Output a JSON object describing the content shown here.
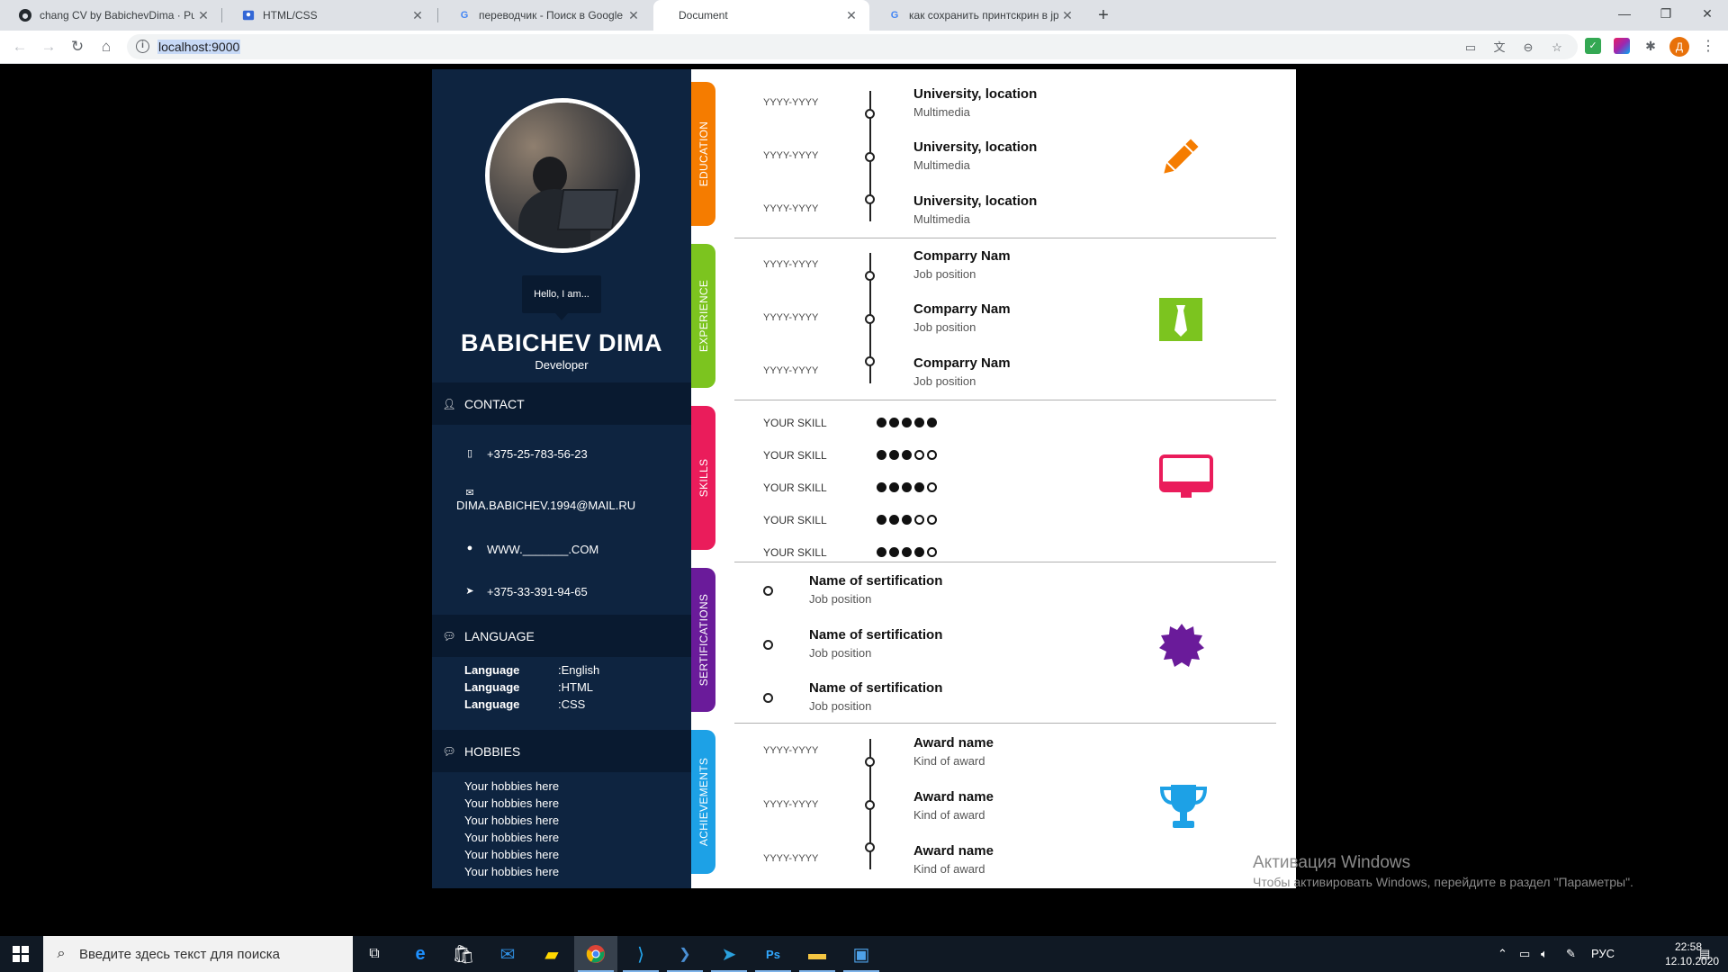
{
  "browser": {
    "tabs": [
      {
        "title": "chang CV by BabichevDima · Pul",
        "icon": "github-icon",
        "active": false
      },
      {
        "title": "HTML/CSS",
        "icon": "page-icon",
        "active": false
      },
      {
        "title": "переводчик - Поиск в Google",
        "icon": "google-icon",
        "active": false
      },
      {
        "title": "Document",
        "icon": "none",
        "active": true
      },
      {
        "title": "как сохранить принтскрин в jpg",
        "icon": "google-icon",
        "active": false
      }
    ],
    "url": "localhost:9000"
  },
  "cv": {
    "greeting": "Hello, I am...",
    "name": "BABICHEV DIMA",
    "role": "Developer",
    "contact": {
      "heading": "CONTACT",
      "phone": "+375-25-783-56-23",
      "email": "DIMA.BABICHEV.1994@MAIL.RU",
      "website": "WWW._______.COM",
      "telegram": "+375-33-391-94-65"
    },
    "language": {
      "heading": "LANGUAGE",
      "items": [
        {
          "label": "Language",
          "value": ":English"
        },
        {
          "label": "Language",
          "value": ":HTML"
        },
        {
          "label": "Language",
          "value": ":CSS"
        }
      ]
    },
    "hobbies": {
      "heading": "HOBBIES",
      "items": [
        "Your hobbies here",
        "Your hobbies here",
        "Your hobbies here",
        "Your hobbies here",
        "Your hobbies here",
        "Your hobbies here"
      ]
    },
    "sections": {
      "education": {
        "label": "EDUCATION",
        "color": "#f57c00",
        "items": [
          {
            "date": "YYYY-YYYY",
            "title": "University, location",
            "sub": "Multimedia"
          },
          {
            "date": "YYYY-YYYY",
            "title": "University, location",
            "sub": "Multimedia"
          },
          {
            "date": "YYYY-YYYY",
            "title": "University, location",
            "sub": "Multimedia"
          }
        ]
      },
      "experience": {
        "label": "EXPERIENCE",
        "color": "#7cc41f",
        "items": [
          {
            "date": "YYYY-YYYY",
            "title": "Comparry Nam",
            "sub": "Job position"
          },
          {
            "date": "YYYY-YYYY",
            "title": "Comparry Nam",
            "sub": "Job position"
          },
          {
            "date": "YYYY-YYYY",
            "title": "Comparry Nam",
            "sub": "Job position"
          }
        ]
      },
      "skills": {
        "label": "SKILLS",
        "color": "#ea1c5b",
        "items": [
          {
            "label": "YOUR SKILL",
            "level": 5
          },
          {
            "label": "YOUR SKILL",
            "level": 3
          },
          {
            "label": "YOUR SKILL",
            "level": 4
          },
          {
            "label": "YOUR SKILL",
            "level": 3
          },
          {
            "label": "YOUR SKILL",
            "level": 4
          }
        ]
      },
      "sertifications": {
        "label": "SERTIFICATIONS",
        "color": "#6a1b9a",
        "items": [
          {
            "title": "Name of sertification",
            "sub": "Job position"
          },
          {
            "title": "Name of sertification",
            "sub": "Job position"
          },
          {
            "title": "Name of sertification",
            "sub": "Job position"
          }
        ]
      },
      "achievements": {
        "label": "ACHIEVEMENTS",
        "color": "#1da1e6",
        "items": [
          {
            "date": "YYYY-YYYY",
            "title": "Award name",
            "sub": "Kind of award"
          },
          {
            "date": "YYYY-YYYY",
            "title": "Award name",
            "sub": "Kind of award"
          },
          {
            "date": "YYYY-YYYY",
            "title": "Award name",
            "sub": "Kind of award"
          }
        ]
      }
    }
  },
  "watermark": {
    "title": "Активация Windows",
    "text": "Чтобы активировать Windows, перейдите в раздел \"Параметры\"."
  },
  "taskbar": {
    "search_placeholder": "Введите здесь текст для поиска",
    "lang": "РУС",
    "time": "22:58",
    "date": "12.10.2020"
  }
}
